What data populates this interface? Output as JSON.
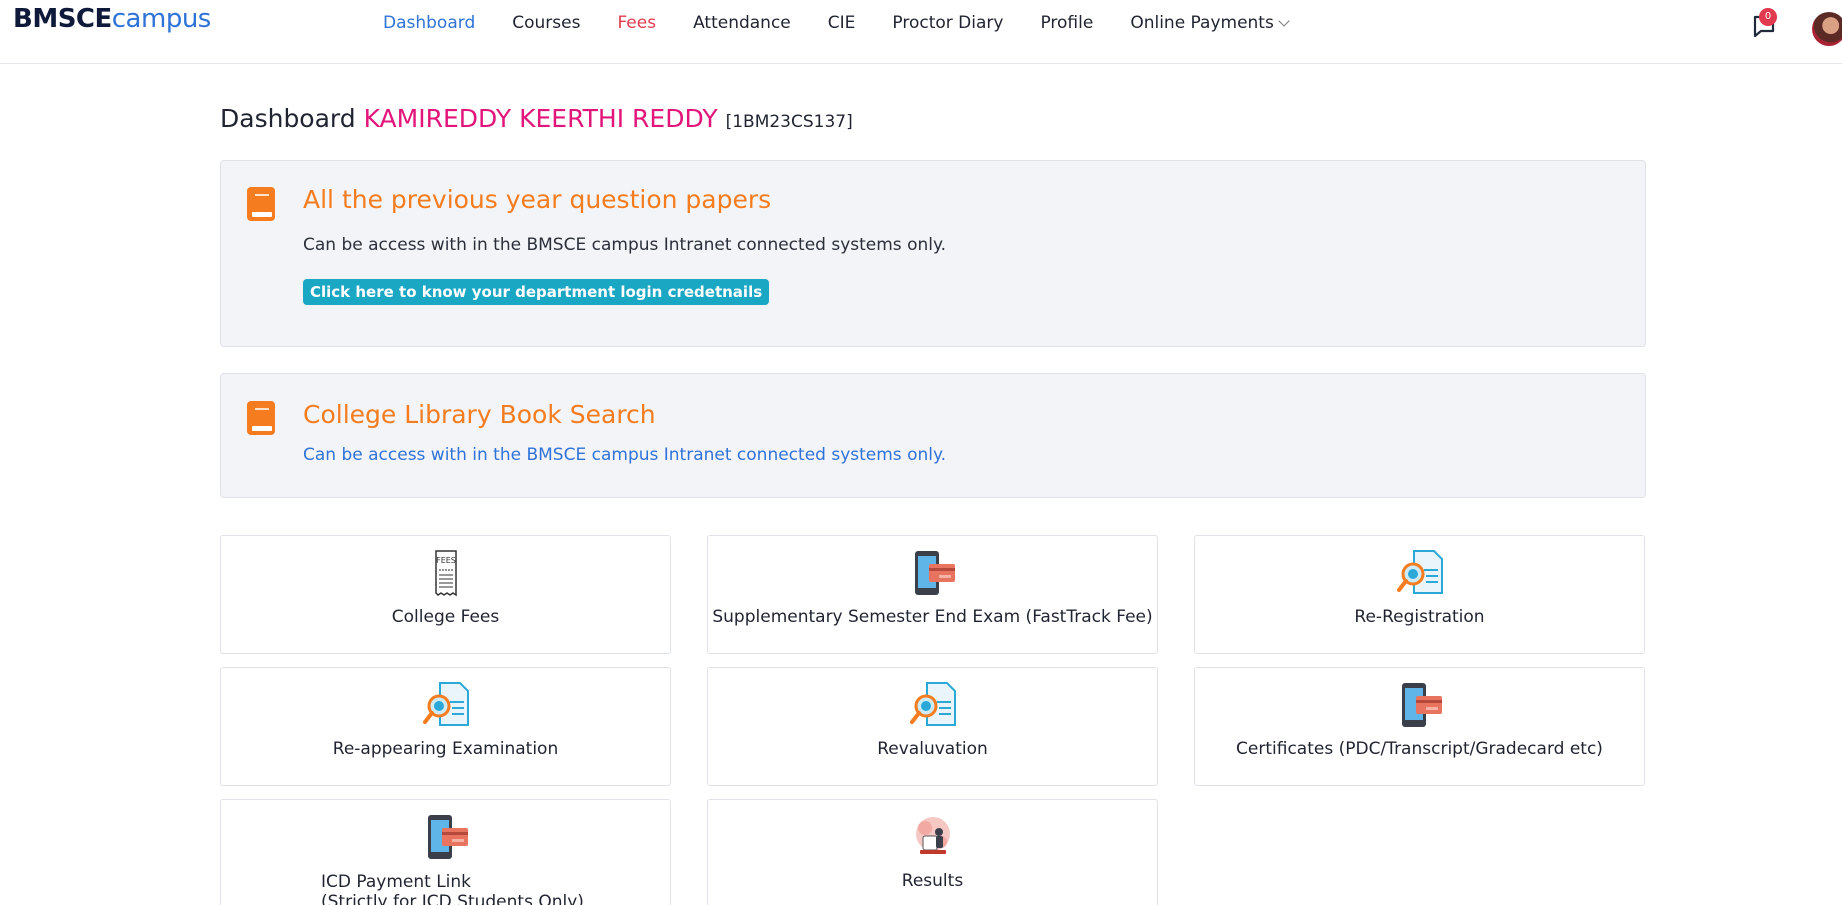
{
  "logo": {
    "bold": "BMSCE",
    "light": "campus"
  },
  "nav": {
    "items": [
      {
        "label": "Dashboard"
      },
      {
        "label": "Courses"
      },
      {
        "label": "Fees"
      },
      {
        "label": "Attendance"
      },
      {
        "label": "CIE"
      },
      {
        "label": "Proctor Diary"
      },
      {
        "label": "Profile"
      },
      {
        "label": "Online Payments"
      }
    ],
    "notification_count": "0",
    "accent": "#2f73d8",
    "fees_color": "#e23a4e"
  },
  "heading": {
    "prefix": "Dashboard",
    "student_name": "KAMIREDDY KEERTHI REDDY",
    "usn": "[1BM23CS137]",
    "name_color": "#e3157a"
  },
  "info_cards": [
    {
      "icon": "book-icon",
      "title": "All the previous year question papers",
      "text": "Can be access with in the BMSCE campus Intranet connected systems only.",
      "button": "Click here to know your department login credetnails"
    },
    {
      "icon": "book-icon",
      "title": "College Library Book Search",
      "text": "Can be access with in the BMSCE campus Intranet connected systems only."
    }
  ],
  "tiles": [
    {
      "label": "College Fees",
      "icon": "fees-receipt-icon"
    },
    {
      "label": "Supplementary Semester End Exam (FastTrack Fee)",
      "icon": "mobile-payment-icon"
    },
    {
      "label": "Re-Registration",
      "icon": "document-search-icon"
    },
    {
      "label": "Re-appearing Examination",
      "icon": "document-search-icon"
    },
    {
      "label": "Revaluvation",
      "icon": "document-search-icon"
    },
    {
      "label": "Certificates (PDC/Transcript/Gradecard etc)",
      "icon": "mobile-payment-icon"
    },
    {
      "label": "ICD Payment Link",
      "sublabel": "(Strictly for ICD Students Only)",
      "icon": "mobile-payment-icon"
    },
    {
      "label": "Results",
      "icon": "results-illustration-icon"
    }
  ],
  "colors": {
    "title_orange": "#f57c1f",
    "button_teal": "#1aa7c4",
    "card_bg": "#f3f4f7"
  }
}
